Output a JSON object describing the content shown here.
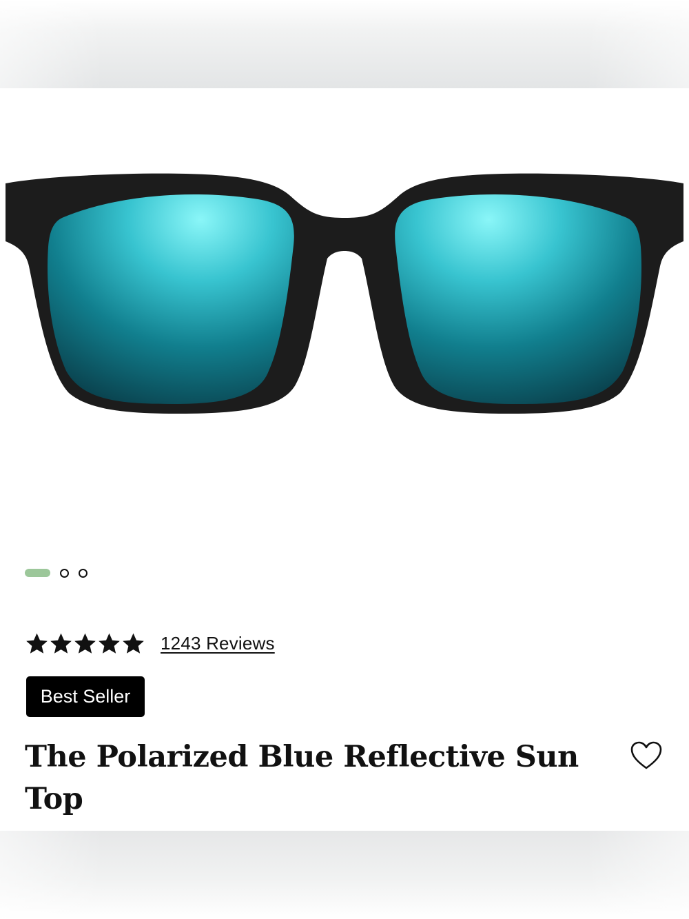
{
  "product": {
    "title": "The Polarized Blue Reflective Sun Top",
    "badge": "Best Seller",
    "rating": {
      "stars": 5,
      "max_stars": 5,
      "reviews_label": "1243 Reviews"
    }
  },
  "gallery": {
    "image_count": 3,
    "active_index": 0
  },
  "icons": {
    "favorite": "heart-outline-icon",
    "star": "star-filled-icon"
  },
  "colors": {
    "frame": "#1c1c1c",
    "lens_light": "#7ff0f4",
    "lens_dark": "#0a3f4a",
    "dot_active": "#9cc79a",
    "badge_bg": "#000000",
    "text": "#111111"
  }
}
